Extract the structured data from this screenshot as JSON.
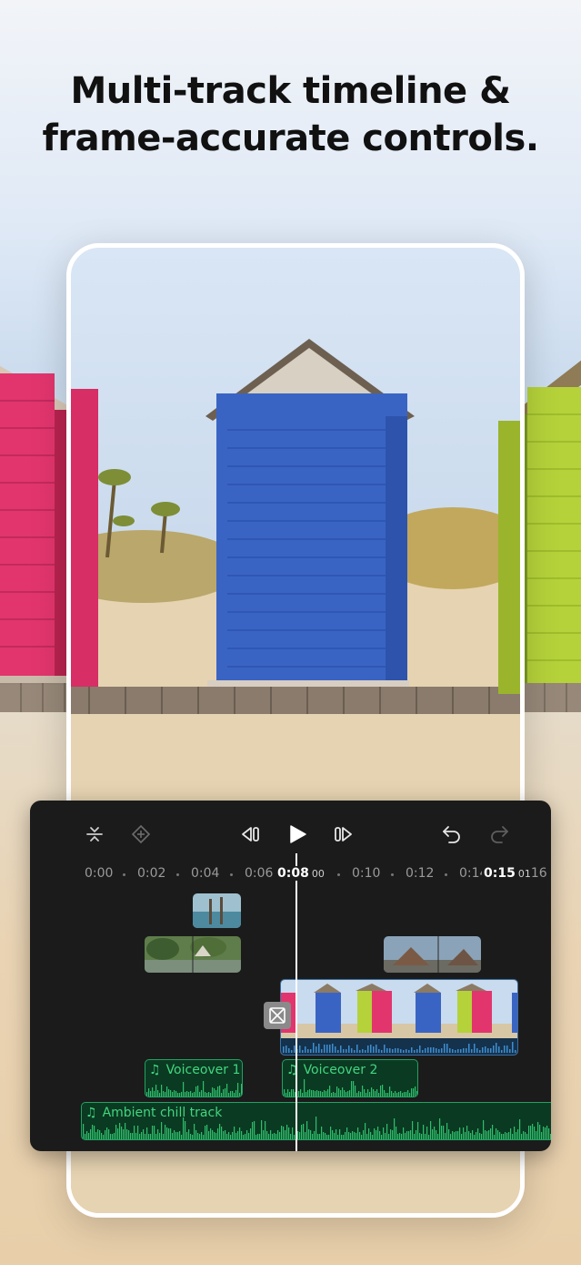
{
  "headline": {
    "line1": "Multi-track timeline &",
    "line2": "frame-accurate controls."
  },
  "colors": {
    "editor_bg": "#1b1b1b",
    "audio_green": "#42d67f",
    "audio_bg": "#0b3a22",
    "hut_blue": "#3a64c4",
    "hut_pink": "#e2356d",
    "hut_green": "#b5d23a"
  },
  "toolbar": {
    "left_icons": [
      "split-icon",
      "keyframe-icon"
    ],
    "center_icons": [
      "step-back-frame-icon",
      "play-icon",
      "step-forward-frame-icon"
    ],
    "right_icons": [
      "undo-icon",
      "redo-icon"
    ]
  },
  "ruler": {
    "ticks": [
      "0:00",
      "0:02",
      "0:04",
      "0:06",
      "0:10",
      "0:12",
      "0:14"
    ],
    "current_time": "0:08",
    "current_frames": "00",
    "end_time": "0:15",
    "end_frames": "01",
    "trailing": "16"
  },
  "tracks": {
    "voiceover1": "Voiceover 1",
    "voiceover2": "Voiceover 2",
    "ambient": "Ambient chill track"
  }
}
